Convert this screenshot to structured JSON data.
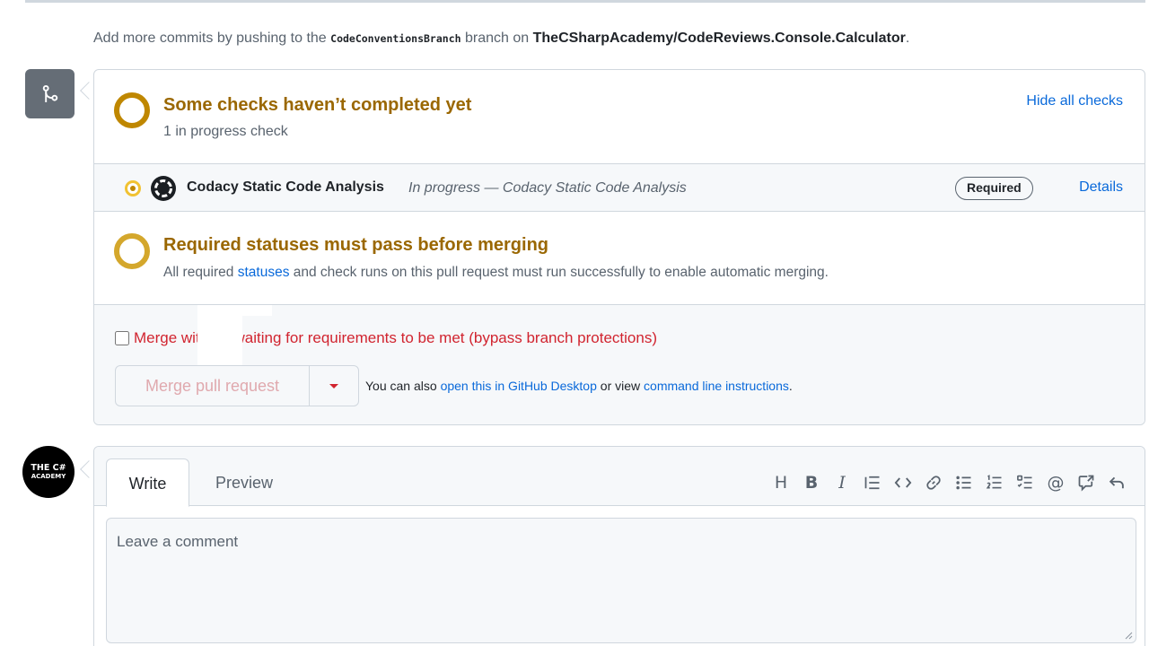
{
  "commit_note": {
    "prefix": "Add more commits by pushing to the",
    "branch": "CodeConventionsBranch",
    "middle": "branch on",
    "repo": "TheCSharpAcademy/CodeReviews.Console.Calculator",
    "suffix": "."
  },
  "checks": {
    "title": "Some checks haven’t completed yet",
    "subtitle": "1 in progress check",
    "hide_label": "Hide all checks",
    "items": [
      {
        "name": "Codacy Static Code Analysis",
        "status": "In progress — Codacy Static Code Analysis",
        "badge": "Required",
        "details_label": "Details",
        "icon": "codacy-icon"
      }
    ]
  },
  "required_status": {
    "title": "Required statuses must pass before merging",
    "text_before": "All required",
    "link": "statuses",
    "text_after": "and check runs on this pull request must run successfully to enable automatic merging."
  },
  "merge": {
    "bypass_label": "Merge without waiting for requirements to be met (bypass branch protections)",
    "bypass_checked": false,
    "button_label": "Merge pull request",
    "also_prefix": "You can also",
    "desktop_link": "open this in GitHub Desktop",
    "also_middle": "or view",
    "cli_link": "command line instructions",
    "also_suffix": "."
  },
  "avatar": {
    "line1": "THE C#",
    "line2": "ACADEMY"
  },
  "comment": {
    "tabs": [
      "Write",
      "Preview"
    ],
    "active_tab": "Write",
    "placeholder": "Leave a comment",
    "toolbar": [
      "heading-icon",
      "bold-icon",
      "italic-icon",
      "quote-icon",
      "code-icon",
      "link-icon",
      "unordered-list-icon",
      "ordered-list-icon",
      "task-list-icon",
      "mention-icon",
      "cross-reference-icon",
      "reply-icon"
    ]
  },
  "colors": {
    "pending": "#bf8700",
    "pending_title": "#9a6700",
    "link": "#0969da",
    "danger": "#d1242f",
    "border": "#d0d7de",
    "muted": "#59636e"
  }
}
